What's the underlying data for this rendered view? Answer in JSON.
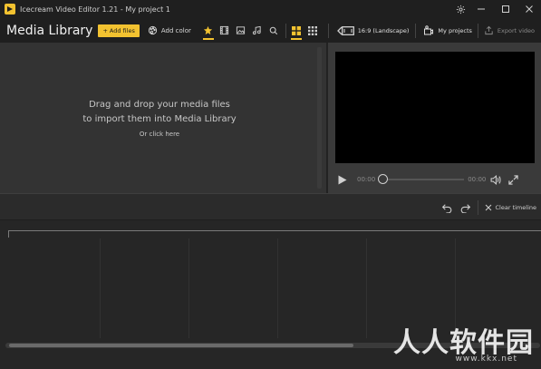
{
  "window": {
    "title": "Icecream Video Editor 1.21 - My project 1",
    "controls": [
      "settings",
      "minimize",
      "maximize",
      "close"
    ]
  },
  "toolbar": {
    "library_title": "Media Library",
    "add_files_label": "Add files",
    "add_color_label": "Add color",
    "filters": [
      "all",
      "video",
      "image",
      "audio",
      "search"
    ],
    "active_filter": "all",
    "views": [
      "grid-large",
      "grid-small"
    ],
    "active_view": "grid-large",
    "aspect_ratio_label": "16:9 (Landscape)",
    "my_projects_label": "My projects",
    "export_label": "Export video"
  },
  "media_library": {
    "drop_line1": "Drag and drop your media files",
    "drop_line2": "to import them into Media Library",
    "or_click": "Or click here"
  },
  "player": {
    "current_time": "00:00",
    "total_time": "00:00",
    "progress": 0
  },
  "timeline": {
    "clear_label": "Clear timeline"
  },
  "watermark": {
    "text": "人人软件园",
    "url": "www.kkx.net"
  },
  "colors": {
    "accent": "#f2c230",
    "bg_dark": "#1f1f1f",
    "panel": "#333333"
  }
}
